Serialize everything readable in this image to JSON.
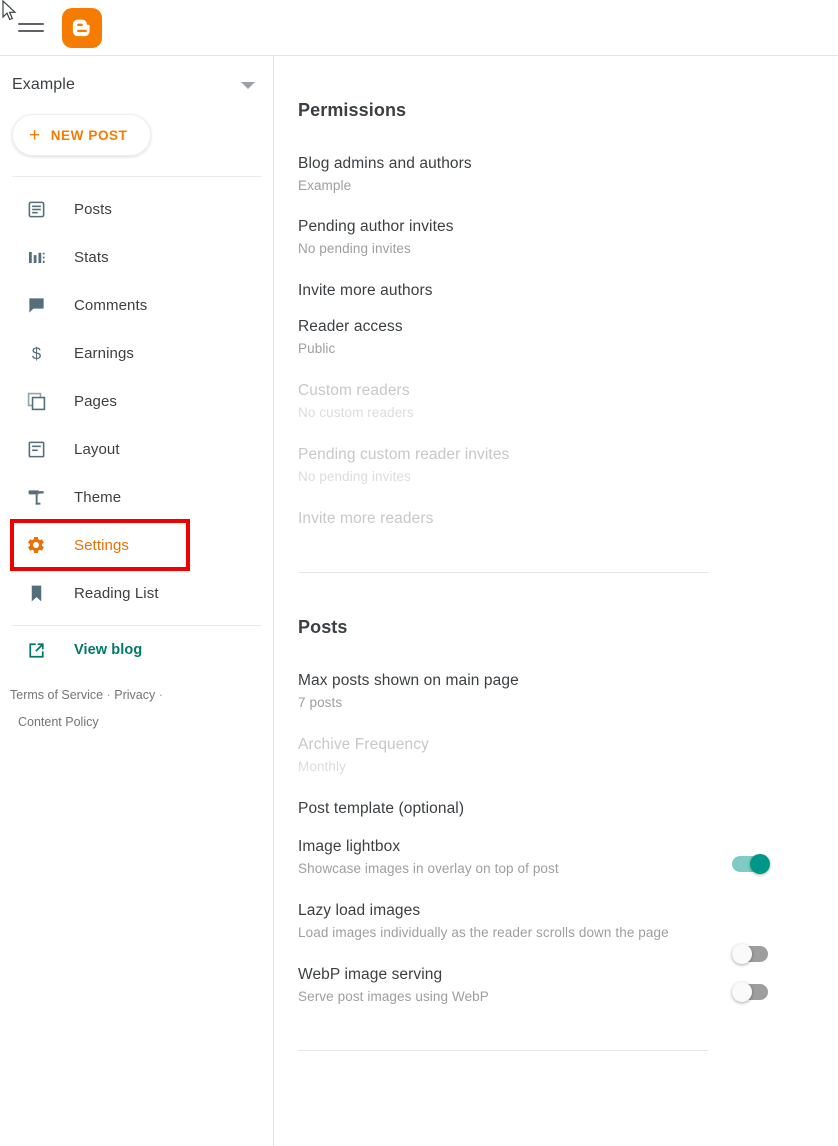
{
  "topbar": {
    "menu_icon": "hamburger-menu-icon",
    "logo_label": "Blogger",
    "logo_color": "#f57c00"
  },
  "sidebar": {
    "blog_name": "Example",
    "blog_selector_icon": "chevron-down-icon",
    "new_post_label": "NEW POST",
    "new_post_icon": "plus-icon",
    "accent_color": "#e8710a",
    "items": [
      {
        "label": "Posts",
        "icon": "posts-icon",
        "active": false
      },
      {
        "label": "Stats",
        "icon": "stats-icon",
        "active": false
      },
      {
        "label": "Comments",
        "icon": "comments-icon",
        "active": false
      },
      {
        "label": "Earnings",
        "icon": "earnings-dollar-icon",
        "active": false
      },
      {
        "label": "Pages",
        "icon": "pages-icon",
        "active": false
      },
      {
        "label": "Layout",
        "icon": "layout-icon",
        "active": false
      },
      {
        "label": "Theme",
        "icon": "theme-paint-roller-icon",
        "active": false
      },
      {
        "label": "Settings",
        "icon": "settings-gear-icon",
        "active": true
      },
      {
        "label": "Reading List",
        "icon": "reading-list-bookmark-icon",
        "active": false
      }
    ],
    "highlighted_item": "Settings",
    "highlight_color": "#f20000",
    "view_blog": {
      "label": "View blog",
      "icon": "external-link-icon",
      "color": "#00796b"
    },
    "legal": {
      "terms": "Terms of Service",
      "privacy": "Privacy",
      "content_policy": "Content Policy",
      "separator": "·"
    }
  },
  "main": {
    "sections": [
      {
        "title": "Permissions",
        "rows": [
          {
            "title": "Blog admins and authors",
            "sub": "Example",
            "dim": false,
            "toggle": null
          },
          {
            "title": "Pending author invites",
            "sub": "No pending invites",
            "dim": false,
            "toggle": null
          },
          {
            "title": "Invite more authors",
            "sub": "",
            "dim": false,
            "toggle": null
          },
          {
            "title": "Reader access",
            "sub": "Public",
            "dim": false,
            "toggle": null
          },
          {
            "title": "Custom readers",
            "sub": "No custom readers",
            "dim": true,
            "toggle": null
          },
          {
            "title": "Pending custom reader invites",
            "sub": "No pending invites",
            "dim": true,
            "toggle": null
          },
          {
            "title": "Invite more readers",
            "sub": "",
            "dim": true,
            "toggle": null
          }
        ]
      },
      {
        "title": "Posts",
        "rows": [
          {
            "title": "Max posts shown on main page",
            "sub": "7 posts",
            "dim": false,
            "toggle": null
          },
          {
            "title": "Archive Frequency",
            "sub": "Monthly",
            "dim": true,
            "toggle": null
          },
          {
            "title": "Post template (optional)",
            "sub": "",
            "dim": false,
            "toggle": null
          },
          {
            "title": "Image lightbox",
            "sub": "Showcase images in overlay on top of post",
            "dim": false,
            "toggle": "on"
          },
          {
            "title": "Lazy load images",
            "sub": "Load images individually as the reader scrolls down the page",
            "dim": false,
            "toggle": "off"
          },
          {
            "title": "WebP image serving",
            "sub": "Serve post images using WebP",
            "dim": false,
            "toggle": "off"
          }
        ]
      }
    ],
    "toggle_on_color": "#009688",
    "toggle_off_color": "#9e9e9e"
  }
}
